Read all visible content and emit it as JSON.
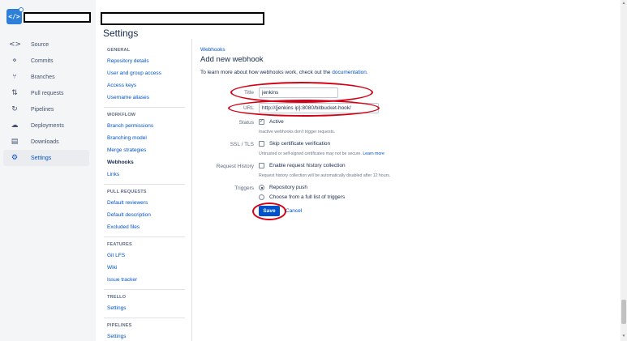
{
  "nav": {
    "logo": "</>",
    "items": [
      {
        "icon": "source-icon",
        "glyph": "<>",
        "label": "Source"
      },
      {
        "icon": "commits-icon",
        "glyph": "⋄",
        "label": "Commits"
      },
      {
        "icon": "branches-icon",
        "glyph": "⑂",
        "label": "Branches"
      },
      {
        "icon": "pull-requests-icon",
        "glyph": "⇅",
        "label": "Pull requests"
      },
      {
        "icon": "pipelines-icon",
        "glyph": "↻",
        "label": "Pipelines"
      },
      {
        "icon": "deployments-icon",
        "glyph": "☁",
        "label": "Deployments"
      },
      {
        "icon": "downloads-icon",
        "glyph": "▤",
        "label": "Downloads"
      },
      {
        "icon": "settings-icon",
        "glyph": "⚙",
        "label": "Settings"
      }
    ]
  },
  "page": {
    "title": "Settings"
  },
  "sidebar": {
    "sections": [
      {
        "title": "GENERAL",
        "links": [
          "Repository details",
          "User and group access",
          "Access keys",
          "Username aliases"
        ]
      },
      {
        "title": "WORKFLOW",
        "links": [
          "Branch permissions",
          "Branching model",
          "Merge strategies",
          "Webhooks",
          "Links"
        ]
      },
      {
        "title": "PULL REQUESTS",
        "links": [
          "Default reviewers",
          "Default description",
          "Excluded files"
        ]
      },
      {
        "title": "FEATURES",
        "links": [
          "Git LFS",
          "Wiki",
          "Issue tracker"
        ]
      },
      {
        "title": "TRELLO",
        "links": [
          "Settings"
        ]
      },
      {
        "title": "PIPELINES",
        "links": [
          "Settings"
        ]
      }
    ],
    "current": "Webhooks"
  },
  "form": {
    "breadcrumb": "Webhooks",
    "heading": "Add new webhook",
    "intro_text": "To learn more about how webhooks work, check out the",
    "intro_link": "documentation",
    "intro_end": ".",
    "title_label": "Title",
    "title_value": "jenkins",
    "url_label": "URL",
    "url_value": "http://{jenkins ip}:8080/bitbucket-hook/",
    "status_label": "Status",
    "status_option": "Active",
    "status_help": "Inactive webhooks don't trigger requests.",
    "ssl_label": "SSL / TLS",
    "ssl_option": "Skip certificate verification",
    "ssl_help": "Untrusted or self-signed certificates may not be secure.",
    "ssl_help_link": "Learn more",
    "history_label": "Request History",
    "history_option": "Enable request history collection",
    "history_help": "Request history collection will be automatically disabled after 12 hours.",
    "triggers_label": "Triggers",
    "trigger_push": "Repository push",
    "trigger_choose": "Choose from a full list of triggers",
    "save_label": "Save",
    "cancel_label": "Cancel"
  },
  "colors": {
    "accent": "#0052cc",
    "annotation": "#d40014",
    "logo": "#2d7fd8"
  }
}
